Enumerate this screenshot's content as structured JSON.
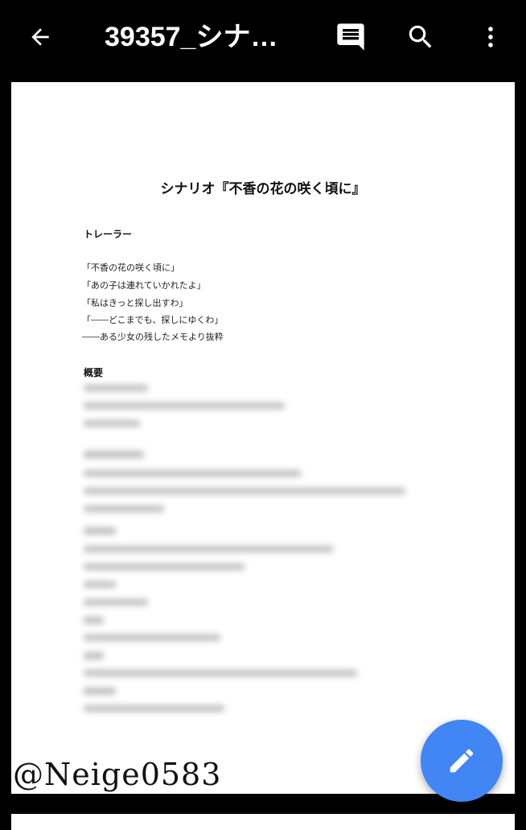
{
  "appbar": {
    "title": "39357_シナ…",
    "icons": [
      "back-arrow-icon",
      "comment-icon",
      "search-icon",
      "more-vert-icon"
    ]
  },
  "document": {
    "title": "シナリオ『不香の花の咲く頃に』",
    "section1_heading": "トレーラー",
    "trailer_lines": [
      "「不香の花の咲く頃に」",
      "「あの子は連れていかれたよ」",
      "「私はきっと探し出すわ」",
      "「――どこまでも、探しにゆくわ」",
      "――ある少女の残したメモより抜粋"
    ],
    "section2_heading": "概要"
  },
  "watermark": "@Neige0583",
  "fab": {
    "icon": "edit-pencil-icon",
    "color": "#4285f4"
  }
}
